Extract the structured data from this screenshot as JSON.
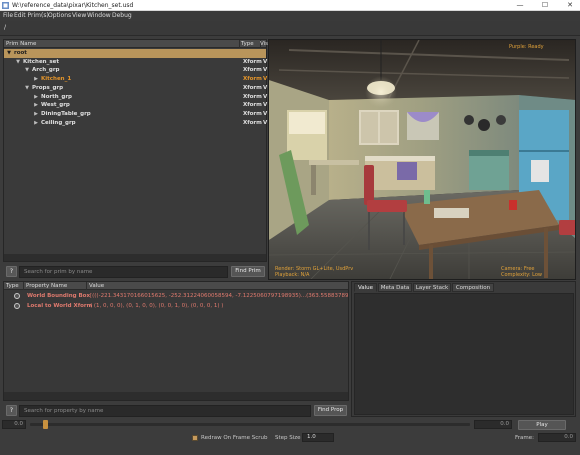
{
  "window": {
    "title": "W:\\reference_data\\pixar\\Kitchen_set.usd",
    "buttons": {
      "minimize": "—",
      "maximize": "☐",
      "close": "✕"
    }
  },
  "menubar": {
    "items": [
      "File",
      "Edit Prim(s)",
      "Options",
      "View",
      "Window",
      "Debug"
    ]
  },
  "path_bar": {
    "path": "/"
  },
  "prim_tree": {
    "headers": {
      "name": "Prim Name",
      "type": "Type",
      "vis": "Vis"
    },
    "rows": [
      {
        "name": "root",
        "type": "",
        "vis": "",
        "selected": true,
        "expanded": true,
        "has_children": true,
        "depth": 0,
        "color": "normal"
      },
      {
        "name": "Kitchen_set",
        "type": "Xform",
        "vis": "V",
        "selected": false,
        "expanded": true,
        "has_children": true,
        "depth": 1,
        "color": "normal"
      },
      {
        "name": "Arch_grp",
        "type": "Xform",
        "vis": "V",
        "selected": false,
        "expanded": true,
        "has_children": true,
        "depth": 2,
        "color": "normal"
      },
      {
        "name": "Kitchen_1",
        "type": "Xform",
        "vis": "V",
        "selected": false,
        "expanded": false,
        "has_children": true,
        "depth": 3,
        "color": "orange"
      },
      {
        "name": "Props_grp",
        "type": "Xform",
        "vis": "V",
        "selected": false,
        "expanded": true,
        "has_children": true,
        "depth": 2,
        "color": "normal"
      },
      {
        "name": "North_grp",
        "type": "Xform",
        "vis": "V",
        "selected": false,
        "expanded": false,
        "has_children": true,
        "depth": 3,
        "color": "normal"
      },
      {
        "name": "West_grp",
        "type": "Xform",
        "vis": "V",
        "selected": false,
        "expanded": false,
        "has_children": true,
        "depth": 3,
        "color": "normal"
      },
      {
        "name": "DiningTable_grp",
        "type": "Xform",
        "vis": "V",
        "selected": false,
        "expanded": false,
        "has_children": true,
        "depth": 3,
        "color": "normal"
      },
      {
        "name": "Ceiling_grp",
        "type": "Xform",
        "vis": "V",
        "selected": false,
        "expanded": false,
        "has_children": true,
        "depth": 3,
        "color": "normal"
      }
    ],
    "search": {
      "help": "?",
      "placeholder": "Search for prim by name",
      "button": "Find Prim"
    }
  },
  "viewport": {
    "hud_top_right": "Purple: Ready",
    "hud_bottom_left": [
      "Render: Storm GL+Lite, UsdPrv",
      "Playback: N/A"
    ],
    "hud_bottom_right": [
      "Camera: Free",
      "Complexity: Low"
    ]
  },
  "properties": {
    "headers": {
      "type": "Type",
      "name": "Property Name",
      "value": "Value"
    },
    "rows": [
      {
        "name": "World Bounding Box",
        "value": "[(((-221.343170166015625, -252.31224060058594, -7.1225060797198935)...(363.558837890625, 196..."
      },
      {
        "name": "Local to World Xform",
        "value": "( (1, 0, 0, 0), (0, 1, 0, 0), (0, 0, 1, 0), (0, 0, 0, 1) )"
      }
    ],
    "search": {
      "help": "?",
      "placeholder": "Search for property by name",
      "button": "Find Prop"
    }
  },
  "value_panel": {
    "tabs": [
      "Value",
      "Meta Data",
      "Layer Stack",
      "Composition"
    ],
    "active_tab": 0
  },
  "timeline": {
    "start": "0.0",
    "end": "0.0",
    "play_label": "Play",
    "progress": 0.03
  },
  "bottom_bar": {
    "redraw_label": "Redraw On Frame Scrub",
    "redraw_checked": true,
    "step_label": "Step Size",
    "step_value": "1.0",
    "frame_label": "Frame:",
    "frame_value": "0.0"
  },
  "colors": {
    "accent": "#b9955b",
    "selection": "#b9955b",
    "orange_text": "#e6962a",
    "property_text": "#e07a6e"
  }
}
